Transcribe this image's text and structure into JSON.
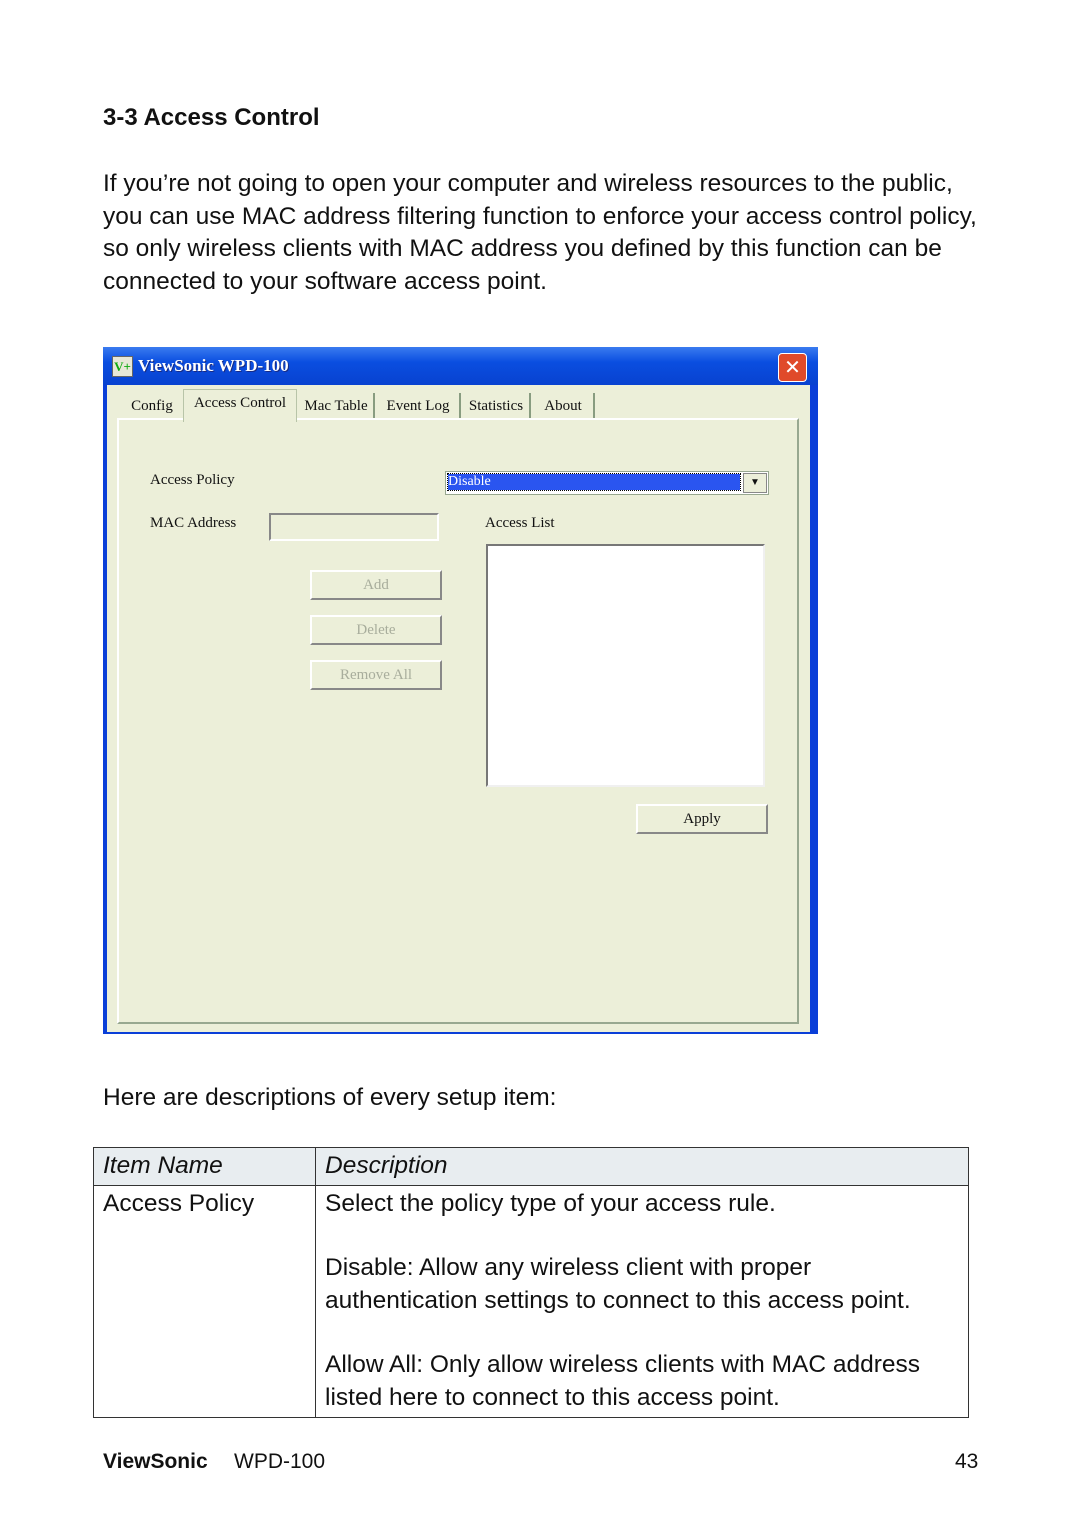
{
  "heading": "3-3 Access Control",
  "intro": "If you’re not going to open your computer and wireless resources to the public, you can use MAC address filtering function to enforce your access control policy, so only wireless clients with MAC address you defined by this function can be connected to your software access point.",
  "window": {
    "title": "ViewSonic  WPD-100",
    "icon_text": "V+",
    "tabs": [
      "Config",
      "Access Control",
      "Mac Table",
      "Event Log",
      "Statistics",
      "About"
    ],
    "active_tab": "Access Control",
    "access_policy_label": "Access Policy",
    "access_policy_value": "Disable",
    "mac_address_label": "MAC Address",
    "mac_address_value": "",
    "access_list_label": "Access List",
    "add_label": "Add",
    "delete_label": "Delete",
    "remove_all_label": "Remove All",
    "apply_label": "Apply"
  },
  "subheading": "Here are descriptions of every setup item:",
  "table": {
    "headers": [
      "Item Name",
      "Description"
    ],
    "rows": [
      {
        "name": "Access Policy",
        "desc": [
          "Select the policy type of your access rule.",
          "Disable: Allow any wireless client with proper authentication settings to connect to this access point.",
          "Allow All: Only allow wireless clients with MAC address listed here to connect to this access point."
        ]
      }
    ]
  },
  "footer": {
    "brand": "ViewSonic",
    "model": "WPD-100",
    "page": "43"
  },
  "colors": {
    "titlebar": "#0a4ee0",
    "window_bg": "#ecefd9",
    "selection": "#2a55f0",
    "close": "#e04a2a",
    "table_header": "#e8edf0"
  }
}
